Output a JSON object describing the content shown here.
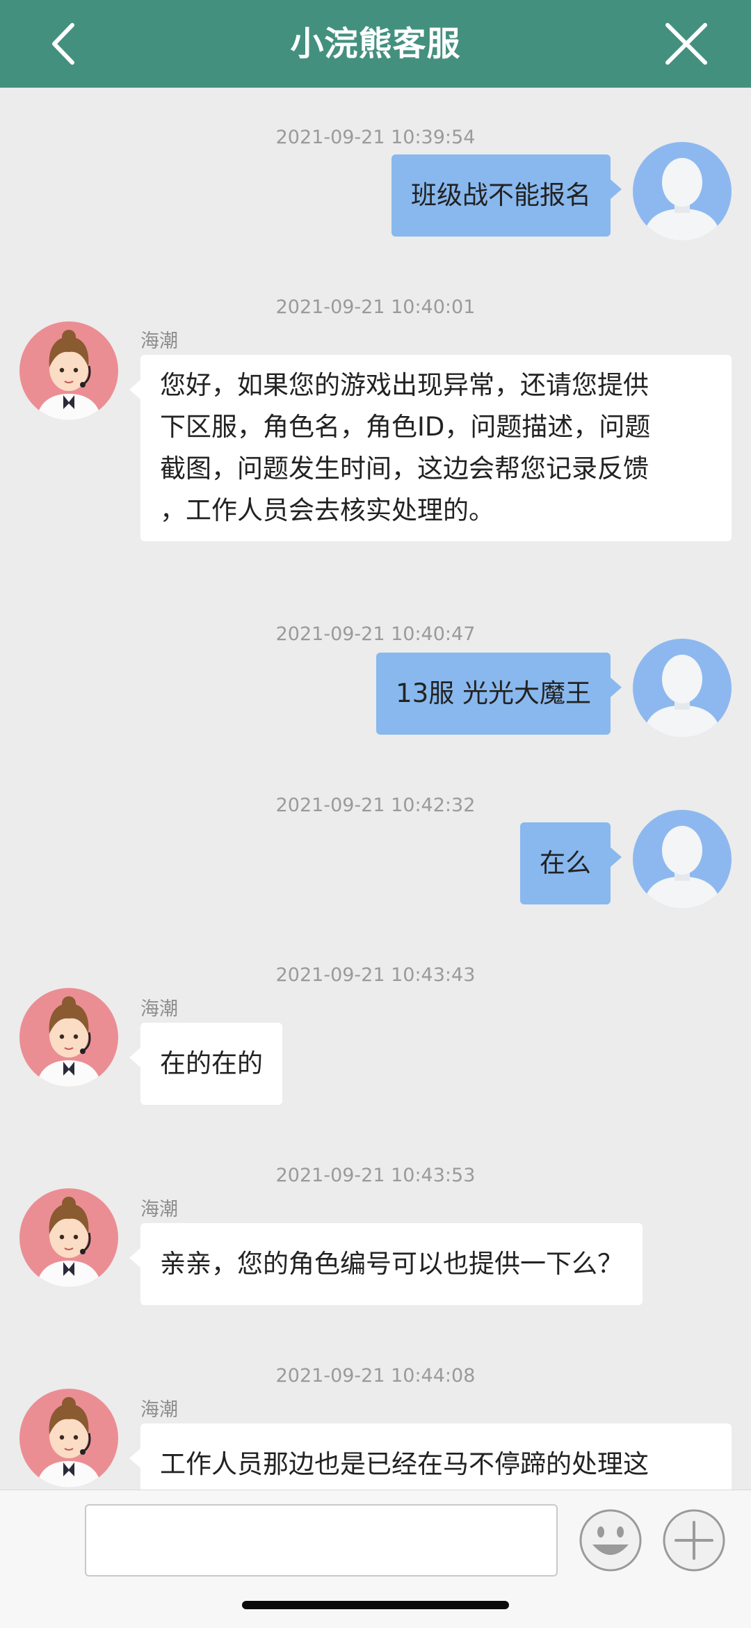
{
  "header": {
    "title": "小浣熊客服",
    "back_icon": "chevron-left-icon",
    "close_icon": "close-icon",
    "color": "#44907f"
  },
  "messages": [
    {
      "direction": "out",
      "timestamp": "2021-09-21 10:39:54",
      "text": "班级战不能报名"
    },
    {
      "direction": "in",
      "timestamp": "2021-09-21 10:40:01",
      "sender": "海潮",
      "lines": [
        "您好，如果您的游戏出现异常，还请您提供",
        "下区服，角色名，角色ID，问题描述，问题",
        "截图，问题发生时间，这边会帮您记录反馈",
        "，工作人员会去核实处理的。"
      ]
    },
    {
      "direction": "out",
      "timestamp": "2021-09-21 10:40:47",
      "text": "13服 光光大魔王"
    },
    {
      "direction": "out",
      "timestamp": "2021-09-21 10:42:32",
      "text": "在么"
    },
    {
      "direction": "in",
      "timestamp": "2021-09-21 10:43:43",
      "sender": "海潮",
      "lines": [
        "在的在的"
      ]
    },
    {
      "direction": "in",
      "timestamp": "2021-09-21 10:43:53",
      "sender": "海潮",
      "lines": [
        "亲亲，您的角色编号可以也提供一下么？"
      ]
    },
    {
      "direction": "in",
      "timestamp": "2021-09-21 10:44:08",
      "sender": "海潮",
      "lines": [
        "工作人员那边也是已经在马不停蹄的处理这"
      ]
    }
  ],
  "composer": {
    "input_value": "",
    "emoji_icon": "smiley-icon",
    "plus_icon": "plus-icon"
  },
  "colors": {
    "outgoing_bubble": "#88b8ee",
    "incoming_bubble": "#ffffff",
    "background": "#ececec"
  }
}
